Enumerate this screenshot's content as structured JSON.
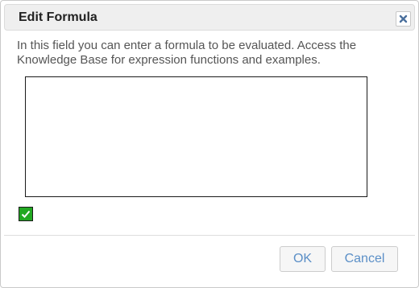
{
  "dialog": {
    "title": "Edit Formula",
    "close_icon": "close-icon",
    "description": "In this field you can enter a formula to be evaluated. Access the Knowledge Base for expression functions and examples.",
    "formula_value": "",
    "checkbox_checked": true,
    "checkbox_color": "#22a822",
    "ok_label": "OK",
    "cancel_label": "Cancel",
    "button_text_color": "#5b8fc7"
  }
}
